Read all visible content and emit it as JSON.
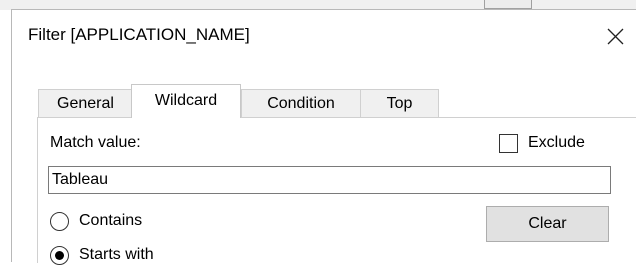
{
  "dialog": {
    "title": "Filter [APPLICATION_NAME]",
    "close_icon": "close-icon"
  },
  "tabs": [
    {
      "label": "General",
      "active": false
    },
    {
      "label": "Wildcard",
      "active": true
    },
    {
      "label": "Condition",
      "active": false
    },
    {
      "label": "Top",
      "active": false
    }
  ],
  "wildcard": {
    "match_label": "Match value:",
    "match_value": "Tableau",
    "exclude_label": "Exclude",
    "exclude_checked": false,
    "options": [
      {
        "label": "Contains",
        "selected": false
      },
      {
        "label": "Starts with",
        "selected": true
      }
    ],
    "clear_label": "Clear"
  }
}
